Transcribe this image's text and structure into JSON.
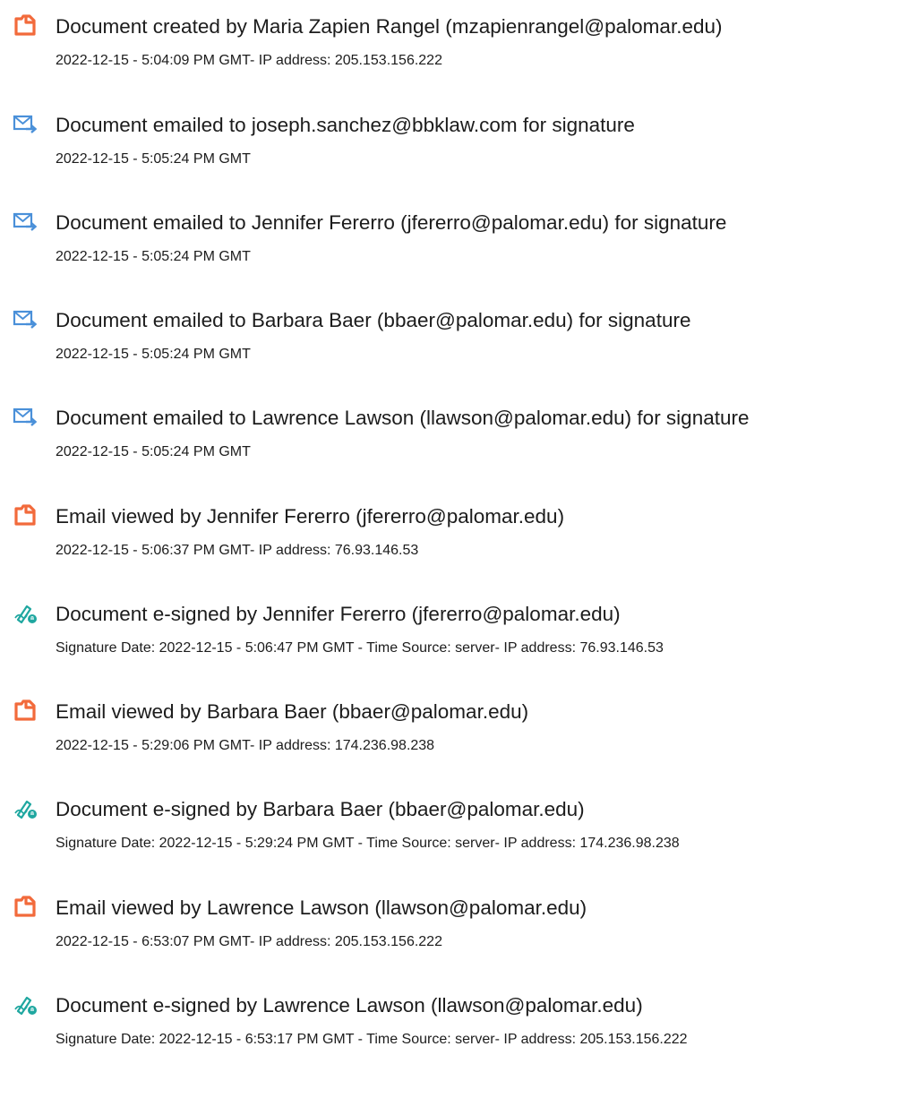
{
  "colors": {
    "doc_icon": "#f26a3b",
    "email_icon": "#4a90d9",
    "sign_icon": "#1fa7a0"
  },
  "events": [
    {
      "icon": "document-icon",
      "title": "Document created by Maria Zapien Rangel (mzapienrangel@palomar.edu)",
      "detail": "2022-12-15 - 5:04:09 PM GMT- IP address: 205.153.156.222"
    },
    {
      "icon": "email-sent-icon",
      "title": "Document emailed to joseph.sanchez@bbklaw.com for signature",
      "detail": "2022-12-15 - 5:05:24 PM GMT"
    },
    {
      "icon": "email-sent-icon",
      "title": "Document emailed to Jennifer Fererro (jfererro@palomar.edu) for signature",
      "detail": "2022-12-15 - 5:05:24 PM GMT"
    },
    {
      "icon": "email-sent-icon",
      "title": "Document emailed to Barbara Baer (bbaer@palomar.edu) for signature",
      "detail": "2022-12-15 - 5:05:24 PM GMT"
    },
    {
      "icon": "email-sent-icon",
      "title": "Document emailed to Lawrence Lawson (llawson@palomar.edu) for signature",
      "detail": "2022-12-15 - 5:05:24 PM GMT"
    },
    {
      "icon": "document-icon",
      "title": "Email viewed by Jennifer Fererro (jfererro@palomar.edu)",
      "detail": "2022-12-15 - 5:06:37 PM GMT- IP address: 76.93.146.53"
    },
    {
      "icon": "esign-icon",
      "title": "Document e-signed by Jennifer Fererro (jfererro@palomar.edu)",
      "detail": "Signature Date: 2022-12-15 - 5:06:47 PM GMT - Time Source: server- IP address: 76.93.146.53"
    },
    {
      "icon": "document-icon",
      "title": "Email viewed by Barbara Baer (bbaer@palomar.edu)",
      "detail": "2022-12-15 - 5:29:06 PM GMT- IP address: 174.236.98.238"
    },
    {
      "icon": "esign-icon",
      "title": "Document e-signed by Barbara Baer (bbaer@palomar.edu)",
      "detail": "Signature Date: 2022-12-15 - 5:29:24 PM GMT - Time Source: server- IP address: 174.236.98.238"
    },
    {
      "icon": "document-icon",
      "title": "Email viewed by Lawrence Lawson (llawson@palomar.edu)",
      "detail": "2022-12-15 - 6:53:07 PM GMT- IP address: 205.153.156.222"
    },
    {
      "icon": "esign-icon",
      "title": "Document e-signed by Lawrence Lawson (llawson@palomar.edu)",
      "detail": "Signature Date: 2022-12-15 - 6:53:17 PM GMT - Time Source: server- IP address: 205.153.156.222"
    }
  ]
}
